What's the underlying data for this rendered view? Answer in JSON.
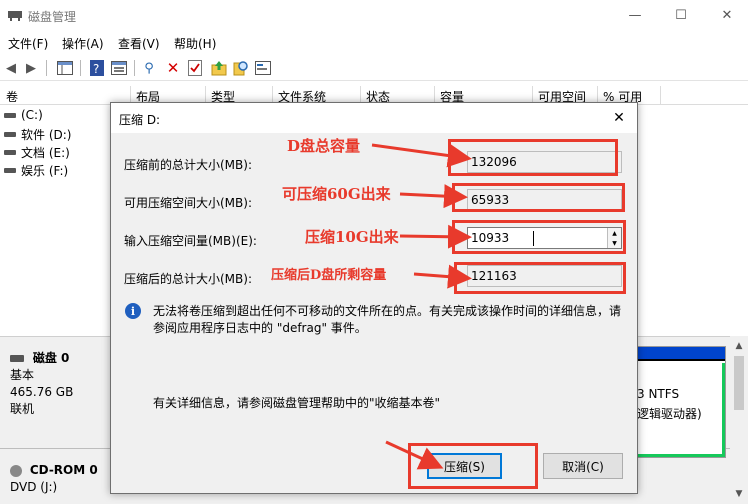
{
  "window": {
    "title": "磁盘管理",
    "controls": [
      "—",
      "☐",
      "✕"
    ]
  },
  "menu": [
    "文件(F)",
    "操作(A)",
    "查看(V)",
    "帮助(H)"
  ],
  "columns": [
    "卷",
    "布局",
    "类型",
    "文件系统",
    "状态",
    "容量",
    "可用空间",
    "% 可用"
  ],
  "volumes": [
    "(C:)",
    "软件 (D:)",
    "文档 (E:)",
    "娱乐 (F:)"
  ],
  "disks": {
    "disk0": {
      "name": "磁盘 0",
      "type": "基本",
      "size": "465.76 GB",
      "status": "联机"
    },
    "cdrom0": {
      "name": "CD-ROM 0",
      "type": "DVD (J:)"
    }
  },
  "partition": {
    "fs": "3 NTFS",
    "desc": "逻辑驱动器)"
  },
  "dialog": {
    "title": "压缩 D:",
    "close": "✕",
    "fields": {
      "total_before": {
        "label": "压缩前的总计大小(MB):",
        "value": "132096"
      },
      "available": {
        "label": "可用压缩空间大小(MB):",
        "value": "65933"
      },
      "input_amount": {
        "label": "输入压缩空间量(MB)(E):",
        "value": "10933"
      },
      "total_after": {
        "label": "压缩后的总计大小(MB):",
        "value": "121163"
      }
    },
    "info": "无法将卷压缩到超出任何不可移动的文件所在的点。有关完成该操作时间的详细信息，请参阅应用程序日志中的 \"defrag\" 事件。",
    "help": "有关详细信息，请参阅磁盘管理帮助中的\"收缩基本卷\"",
    "shrink_button": "压缩(S)",
    "cancel_button": "取消(C)"
  },
  "annotations": {
    "total_d": "D盘总容量",
    "shrinkable": "可压缩60G出来",
    "shrink_10g": "压缩10G出来",
    "remaining": "压缩后D盘所剩容量"
  },
  "colors": {
    "annotation_red": "#e83a2c",
    "accent_blue": "#0078d7",
    "partition_blue": "#0044cc",
    "partition_green": "#16c95b"
  }
}
